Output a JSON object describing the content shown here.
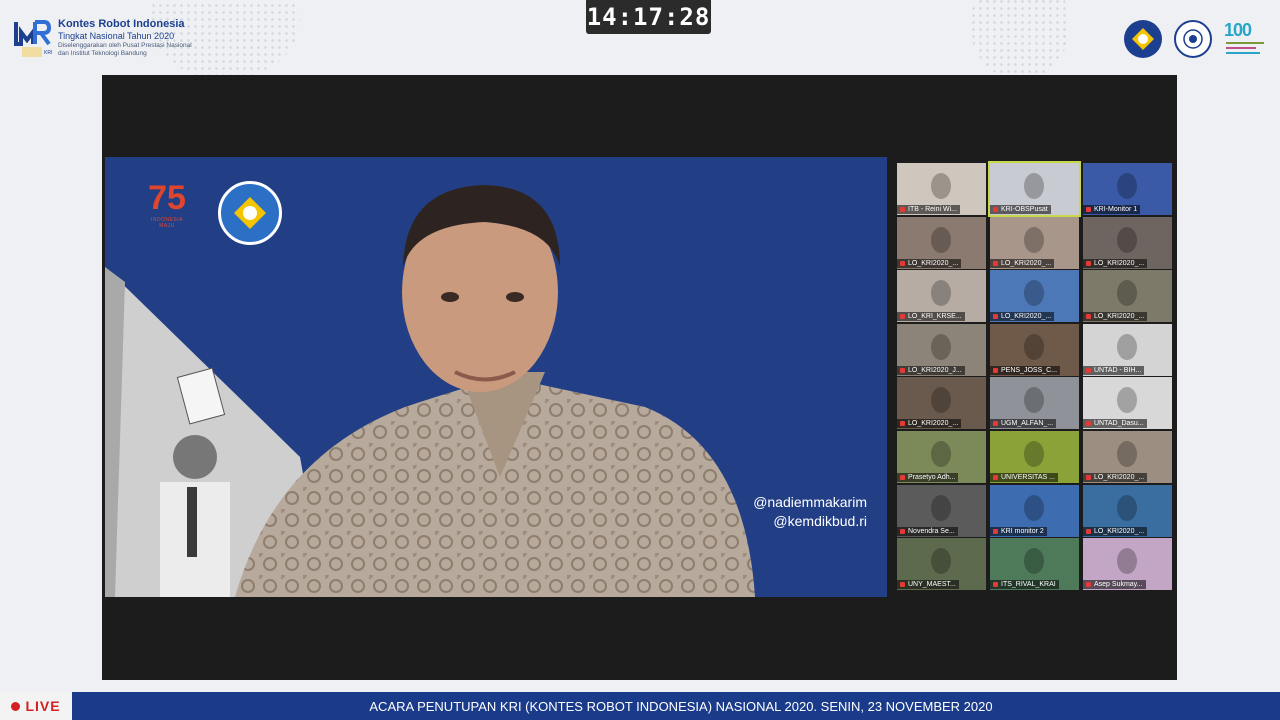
{
  "header": {
    "brand_title": "Kontes Robot Indonesia",
    "brand_subtitle": "Tingkat Nasional Tahun 2020",
    "brand_org": "Diselenggarakan oleh Pusat Prestasi Nasional dan Institut Teknologi Bandung",
    "logo_text": "KRI",
    "clock": "14:17:28",
    "logo_100_text": "100"
  },
  "speaker": {
    "handle_1": "@nadiemmakarim",
    "handle_2": "@kemdikbud.ri",
    "logo_75_text": "75",
    "logo_75_caption": "INDONESIA MAJU"
  },
  "gallery": {
    "participants": [
      {
        "name": "ITB - Reini Wi...",
        "color": "#cfc6bd"
      },
      {
        "name": "KRI-OBSPusat",
        "color": "#c9cbd3"
      },
      {
        "name": "KRI-Monitor 1",
        "color": "#3a5aa8"
      },
      {
        "name": "LO_KRI2020_...",
        "color": "#8a7a70"
      },
      {
        "name": "LO_KRI2020_...",
        "color": "#a8968a"
      },
      {
        "name": "LO_KRI2020_...",
        "color": "#6e6560"
      },
      {
        "name": "LO_KRI_KRSE...",
        "color": "#b7aca4"
      },
      {
        "name": "LO_KRI2020_...",
        "color": "#4d78b8"
      },
      {
        "name": "LO_KRI2020_...",
        "color": "#7e7a6a"
      },
      {
        "name": "LO_KRI2020_J...",
        "color": "#8c8478"
      },
      {
        "name": "PENS_JOSS_C...",
        "color": "#6f5a4a"
      },
      {
        "name": "UNTAD - BIH...",
        "color": "#d4d4d4"
      },
      {
        "name": "LO_KRI2020_...",
        "color": "#6a5a4e"
      },
      {
        "name": "UGM_ALFAN_...",
        "color": "#8f9399"
      },
      {
        "name": "UNTAD_Dasu...",
        "color": "#d8d8d8"
      },
      {
        "name": "Prasetyo Adh...",
        "color": "#7c8a5a"
      },
      {
        "name": "UNIVERSITAS ...",
        "color": "#8aa238"
      },
      {
        "name": "LO_KRI2020_...",
        "color": "#9c8f82"
      },
      {
        "name": "Novendra Se...",
        "color": "#5b5b5b"
      },
      {
        "name": "KRI monitor 2",
        "color": "#3d6db0"
      },
      {
        "name": "LO_KRI2020_...",
        "color": "#3a6ea0"
      },
      {
        "name": "UNY_MAEST...",
        "color": "#5d6a4e"
      },
      {
        "name": "ITS_RIVAL_KRAI",
        "color": "#4e7a5a"
      },
      {
        "name": "Asep Sukmay...",
        "color": "#c3a6c6"
      }
    ]
  },
  "ticker": {
    "live_label": "LIVE",
    "text": "ACARA PENUTUPAN KRI (KONTES ROBOT INDONESIA) NASIONAL 2020.  SENIN, 23 NOVEMBER 2020"
  },
  "colors": {
    "ticker_bg": "#1a3a8a",
    "speaker_bg": "#223f86",
    "live_red": "#d42020",
    "brand_blue": "#1d3f8f"
  }
}
